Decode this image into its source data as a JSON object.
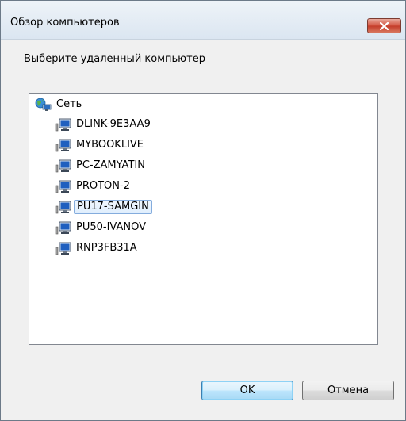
{
  "window": {
    "title": "Обзор компьютеров",
    "prompt": "Выберите удаленный компьютер"
  },
  "tree": {
    "root": {
      "label": "Сеть",
      "icon": "network-globe-icon"
    },
    "items": [
      {
        "label": "DLINK-9E3AA9",
        "icon": "computer-icon",
        "selected": false
      },
      {
        "label": "MYBOOKLIVE",
        "icon": "computer-icon",
        "selected": false
      },
      {
        "label": "PC-ZAMYATIN",
        "icon": "computer-icon",
        "selected": false
      },
      {
        "label": "PROTON-2",
        "icon": "computer-icon",
        "selected": false
      },
      {
        "label": "PU17-SAMGIN",
        "icon": "computer-icon",
        "selected": true
      },
      {
        "label": "PU50-IVANOV",
        "icon": "computer-icon",
        "selected": false
      },
      {
        "label": "RNP3FB31A",
        "icon": "computer-icon",
        "selected": false
      }
    ]
  },
  "buttons": {
    "ok": "OK",
    "cancel": "Отмена"
  },
  "colors": {
    "selection_border": "#84acdd",
    "close_button": "#c33a27"
  }
}
